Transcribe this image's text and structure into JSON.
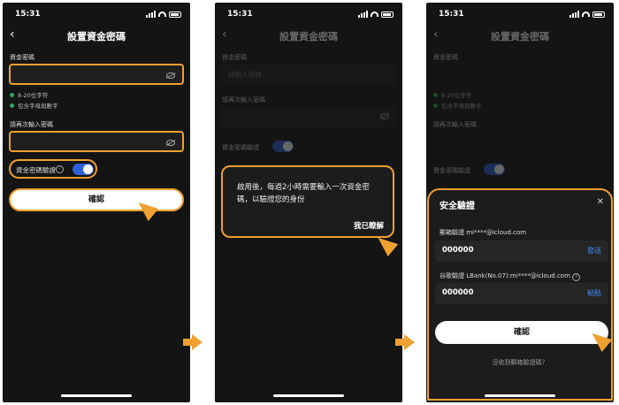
{
  "status": {
    "time": "15:31"
  },
  "page": {
    "title": "設置資金密碼"
  },
  "form": {
    "fund_password_label": "資金密碼",
    "fund_password_placeholder": "請輸入密碼",
    "rules": [
      "8-20位字符",
      "包含字母與數字"
    ],
    "repeat_label": "請再次輸入密碼",
    "verify_label": "資金密碼驗證",
    "confirm_label": "確認"
  },
  "dialog": {
    "message": "啟用後，每過2小時需要輸入一次資金密碼，以驗證您的身份",
    "ok_label": "我已瞭解"
  },
  "sheet": {
    "title": "安全驗證",
    "email_label": "郵箱驗證 mi****@icloud.com",
    "email_code": "000000",
    "send_label": "發送",
    "google_label": "谷歌驗證 LBank(No.07):mi****@icloud.com",
    "google_code": "000000",
    "paste_label": "粘貼",
    "confirm_label": "確認",
    "resend_link": "沒收到郵箱驗證碼？"
  },
  "colors": {
    "highlight": "#f0a030",
    "toggle": "#2d5fd8",
    "rule_dot": "#2fa861",
    "link": "#3f8fff"
  }
}
